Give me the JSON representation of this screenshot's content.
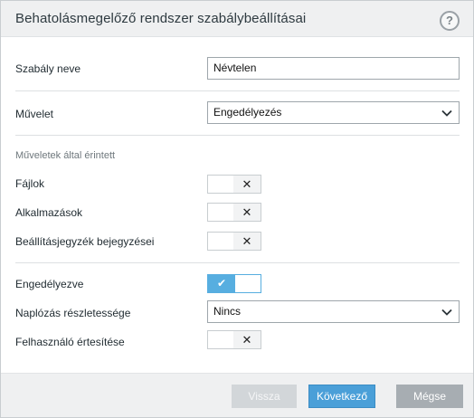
{
  "dialog": {
    "title": "Behatolásmegelőző rendszer szabálybeállításai",
    "help_symbol": "?"
  },
  "form": {
    "rule_name_label": "Szabály neve",
    "rule_name_value": "Névtelen",
    "action_label": "Művelet",
    "action_value": "Engedélyezés",
    "affected_section_label": "Műveletek által érintett",
    "files_label": "Fájlok",
    "files_enabled": false,
    "applications_label": "Alkalmazások",
    "applications_enabled": false,
    "registry_label": "Beállításjegyzék bejegyzései",
    "registry_enabled": false,
    "enabled_label": "Engedélyezve",
    "enabled_value": true,
    "logging_label": "Naplózás részletessége",
    "logging_value": "Nincs",
    "notify_label": "Felhasználó értesítése",
    "notify_enabled": false
  },
  "toggle_glyphs": {
    "off": "✕",
    "on": "✔"
  },
  "footer": {
    "back_label": "Vissza",
    "next_label": "Következő",
    "cancel_label": "Mégse"
  },
  "colors": {
    "accent": "#4a9fd8",
    "toggle_on": "#57aee0",
    "header_bg": "#eff0f1",
    "disabled_button": "#d2d6d9",
    "cancel_button": "#a7adb2"
  }
}
